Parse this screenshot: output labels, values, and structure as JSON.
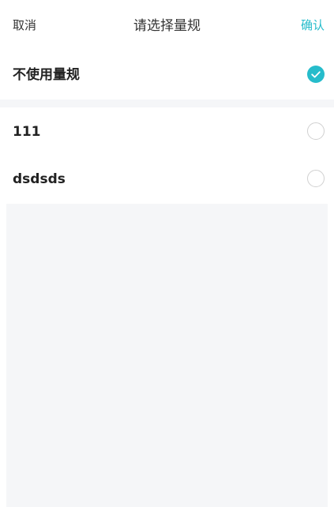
{
  "header": {
    "cancel_label": "取消",
    "title": "请选择量规",
    "confirm_label": "确认"
  },
  "options": [
    {
      "label": "不使用量规",
      "selected": true
    },
    {
      "label": "111",
      "selected": false
    },
    {
      "label": "dsdsds",
      "selected": false
    }
  ],
  "colors": {
    "accent": "#26bccb",
    "radio_border": "#d0d0d0",
    "background_gray": "#f5f6f8"
  },
  "icons": {
    "checked": "check-circle-icon",
    "unchecked": "empty-circle-icon"
  }
}
